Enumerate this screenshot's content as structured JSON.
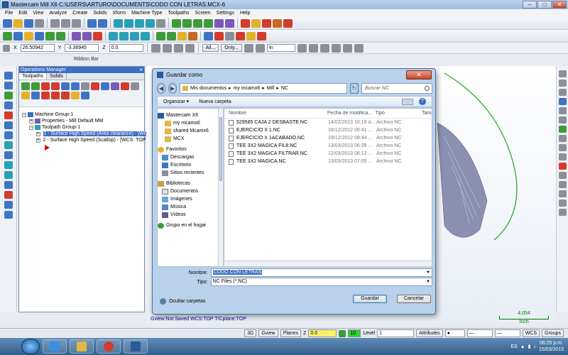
{
  "app": {
    "title": "Mastercam Mill X6  C:\\USERS\\ARTURO\\DOCUMENTS\\CODO CON LETRAS.MCX-6"
  },
  "menu": [
    "File",
    "Edit",
    "View",
    "Analyze",
    "Create",
    "Solids",
    "Xform",
    "Machine Type",
    "Toolpaths",
    "Screen",
    "Settings",
    "Help"
  ],
  "ribbon": {
    "x_value": "26.50942",
    "y_value": "-3.36945",
    "z_value": "0.0",
    "all_label": "All...",
    "only_label": "Only...",
    "mode_value": "In",
    "ribbon_bar_label": "Ribbon Bar"
  },
  "ops_manager": {
    "title": "Operations Manager",
    "tabs": [
      "Toolpaths",
      "Solids"
    ],
    "tree": [
      "Machine Group-1",
      "Properties - Mill Default MM",
      "Toolpath Group-1",
      "1 - Surface High Speed (Area clearance) - [WCS",
      "2 - Surface High Speed (Scallop) - [WCS: TOP] -"
    ]
  },
  "graphics": {
    "status": "Gview:Not Saved   WCS:TOP   T/Cplane:TOP",
    "scale_value": "4.054",
    "scale_unit": "Inch",
    "toolpath_color": "#2fa82f"
  },
  "dialog": {
    "title": "Guardar como",
    "path": [
      "Mis documentos",
      "my mcamx6",
      "Mill",
      "NC"
    ],
    "search_placeholder": "Buscar NC",
    "organize_label": "Organizar ▾",
    "new_folder_label": "Nueva carpeta",
    "nav": {
      "top": "Mastercam X6",
      "subfolders": [
        "my mcamx6",
        "shared Mcamx6",
        "MCX"
      ],
      "favorites_label": "Favoritos",
      "favorites": [
        "Descargas",
        "Escritorio",
        "Sitios recientes"
      ],
      "libraries_label": "Bibliotecas",
      "libraries": [
        "Documentos",
        "Imágenes",
        "Música",
        "Vídeos"
      ],
      "homegroup_label": "Grupo en el hogar"
    },
    "columns": {
      "name": "Nombre",
      "date": "Fecha de modifica...",
      "type": "Tipo",
      "size": "Tama"
    },
    "files": [
      {
        "name": "529585 CAJA 2 DESBASTE.NC",
        "date": "14/02/2013 10:19 a...",
        "type": "Archivo NC"
      },
      {
        "name": "EJERCICIO X 1.NC",
        "date": "16/12/2012 09:41 ...",
        "type": "Archivo NC"
      },
      {
        "name": "EJERCICIO X 1ACABADO.NC",
        "date": "19/12/2012 09:44 ...",
        "type": "Archivo NC"
      },
      {
        "name": "TEE 3X2 MAGICA FIL8.NC",
        "date": "13/03/2013 06:39 ...",
        "type": "Archivo NC"
      },
      {
        "name": "TEE 3X2 MAGICA FILTRAR.NC",
        "date": "12/03/2013 08:12 ...",
        "type": "Archivo NC"
      },
      {
        "name": "TEE 3X2 MAGICA.NC",
        "date": "13/03/2013 07:05 ...",
        "type": "Archivo NC"
      }
    ],
    "filename_label": "Nombre:",
    "filename_value": "CODO CON LETRAS",
    "filetype_label": "Tipo:",
    "filetype_value": "NC Files (*.NC)",
    "hide_folders_label": "Ocultar carpetas",
    "save_label": "Guardar",
    "cancel_label": "Cancelar"
  },
  "statusbar": {
    "btn_3d": "3D",
    "btn_gview": "Gview",
    "btn_planes": "Planes",
    "z_label": "Z",
    "z_value": "0.0",
    "color_value": "10",
    "level_label": "Level",
    "level_value": "1",
    "attributes_label": "Attributes",
    "wcs_label": "WCS",
    "groups_label": "Groups"
  },
  "taskbar": {
    "lang": "ES",
    "time": "06:25 p.m.",
    "date": "15/03/2013"
  }
}
